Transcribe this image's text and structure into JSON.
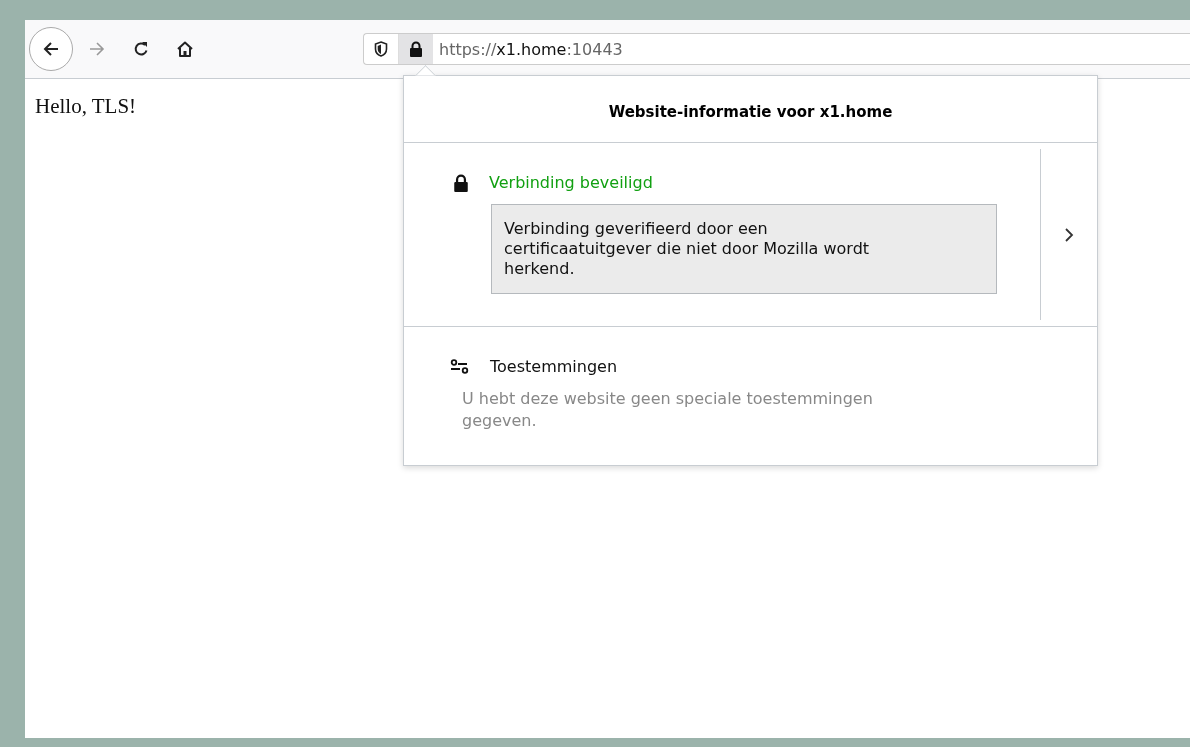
{
  "toolbar": {
    "back": {
      "disabled": false
    },
    "forward": {
      "disabled": true
    },
    "url": {
      "scheme": "https://",
      "host": "x1.home",
      "port": ":10443"
    }
  },
  "page": {
    "text": "Hello, TLS!"
  },
  "site_info_panel": {
    "title": "Website-informatie voor x1.home",
    "connection": {
      "secure": true,
      "status": "Verbinding beveiligd",
      "detail": "Verbinding geverifieerd door een certificaatuitgever die niet door Mozilla wordt herkend."
    },
    "permissions": {
      "heading": "Toestemmingen",
      "text": "U hebt deze website geen speciale toestemmingen gegeven."
    }
  }
}
